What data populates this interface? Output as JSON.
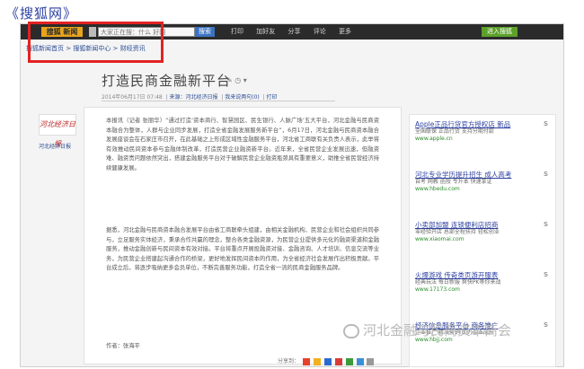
{
  "outer_title": "《搜狐网》",
  "topbar": {
    "logo_label": "搜狐 新闻",
    "search_placeholder": "大家正在搜：什么 好网",
    "search_button": "搜索",
    "nav": [
      "打印",
      "加好友",
      "分享",
      "评论",
      "更多"
    ],
    "login_button": "进入搜狐"
  },
  "breadcrumb": "搜狐新闻首页 > 搜狐新闻中心 > 财经资讯",
  "article": {
    "headline": "打造民商金融新平台",
    "head_icons": "✎ ◷ ▾",
    "meta_date": "2014年06月17日 07:48",
    "meta_source": "来源：河北经济日报",
    "meta_comments": "我来说两句(0)",
    "meta_print": "打印",
    "paragraph_1": "本报讯（记者 张丽华）“通过打造‘资本商行、智慧园区、民生银行、人脉广场’五大平台，河北金融与民商资本融合为整体，人群与企业同步发展，打造全省金融发展服务新平台”，6月17日，河北金融与民商资本融合发展座谈会在石家庄市召开，在此基础之上形成区域性金融服务平台，河北省工商联有关负责人表示，此举将有效推动民间资本参与金融体制改革，打造民营企业融资新平台。近年来，全省民营企业发展迅速，但融资难、融资贵问题依然突出，搭建金融服务平台对于破解民营企业融资瓶颈具有重要意义，助推全省民营经济持续健康发展。",
    "paragraph_2": "据悉，河北金融与民商资本融合发展平台由省工商联牵头组建，由相关金融机构、民营企业和社会组织共同参与，立足服务实体经济，秉承合作共赢的理念，整合各类金融资源，为民营企业提供多元化的融资渠道和金融服务，推动金融创新与民间资本有效对接。平台将重点开展投融资对接、金融咨询、人才培训、信息交流等业务，为民营企业搭建起沟通合作的桥梁，更好地发挥民间资本的作用，为全省经济社会发展作出积极贡献。平台成立后，将逐步吸纳更多会员单位，不断完善服务功能，打造全省一流的民商金融服务品牌。",
    "author": "作者：张海平",
    "share_label": "分享到："
  },
  "source": {
    "logo_text": "河北经济日报",
    "link": "河北经济日报"
  },
  "sidebar": {
    "ads": [
      {
        "title": "Apple正品行货官方授权店 新品",
        "desc": "全国联保 正品行货 支持分期付款",
        "url": "www.apple.cn",
        "mark": "S"
      },
      {
        "title": "河北专业学历提升招生 成人高考",
        "desc": "自考 网教 函授 专升本 快速拿证",
        "url": "www.hbedu.com",
        "mark": "S"
      },
      {
        "title": "小卖部加盟 连锁便利店招商",
        "desc": "零经验开店 总部全程扶持 轻松创业",
        "url": "www.xiaomai.com",
        "mark": "S"
      },
      {
        "title": "火爆游戏 传奇类页游开服表",
        "desc": "经典玩法 每日新服 爽快PK等你来战",
        "url": "www.17173.com",
        "mark": "S"
      },
      {
        "title": "经济信息服务平台 商务推广",
        "desc": "企业推广 精准营销 助力企业成长",
        "url": "www.hbjj.com",
        "mark": "S"
      }
    ]
  },
  "watermark": "河北金融与民商资本商会"
}
